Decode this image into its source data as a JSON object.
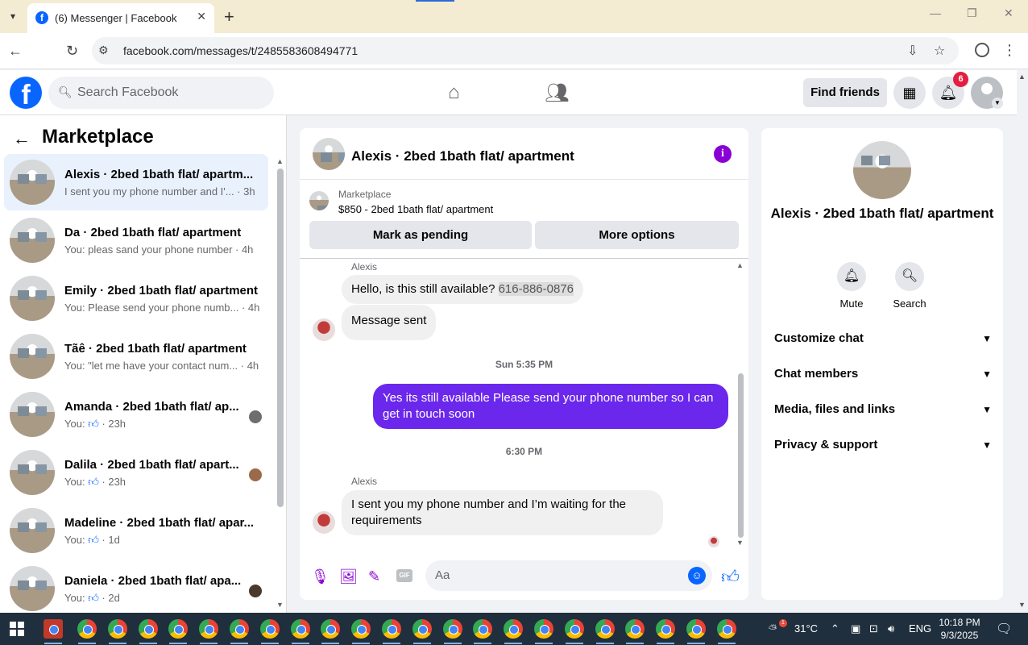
{
  "browser": {
    "tab_title": "(6) Messenger | Facebook",
    "url": "facebook.com/messages/t/2485583608494771"
  },
  "header": {
    "search_placeholder": "Search Facebook",
    "find_friends": "Find friends",
    "notification_count": "6"
  },
  "sidebar": {
    "title": "Marketplace",
    "conversations": [
      {
        "name": "Alexis · 2bed 1bath flat/ apartm...",
        "preview": "I sent you my phone number and I'... · 3h",
        "active": true
      },
      {
        "name": "Da · 2bed 1bath flat/ apartment",
        "preview": "You: pleas sand your phone number · 4h"
      },
      {
        "name": "Emily · 2bed 1bath flat/ apartment",
        "preview": "You: Please send your phone numb... · 4h"
      },
      {
        "name": "Tãê · 2bed 1bath flat/ apartment",
        "preview": "You: \"let me have your contact num... · 4h"
      },
      {
        "name": "Amanda · 2bed 1bath flat/ ap...",
        "preview_prefix": "You:",
        "preview_suffix": "· 23h"
      },
      {
        "name": "Dalila · 2bed 1bath flat/ apart...",
        "preview_prefix": "You:",
        "preview_suffix": "· 23h"
      },
      {
        "name": "Madeline · 2bed 1bath flat/ apar...",
        "preview_prefix": "You:",
        "preview_suffix": "· 1d"
      },
      {
        "name": "Daniela · 2bed 1bath flat/ apa...",
        "preview_prefix": "You:",
        "preview_suffix": "· 2d"
      }
    ]
  },
  "chat": {
    "title": "Alexis · 2bed 1bath flat/ apartment",
    "marketplace_label": "Marketplace",
    "listing": "$850 - 2bed 1bath flat/ apartment",
    "mark_pending": "Mark as pending",
    "more_options": "More options",
    "messages": {
      "sender1": "Alexis",
      "msg1_text": "Hello, is this still available?",
      "msg1_phone": "616-886-0876",
      "msg2": "Message sent",
      "time1": "Sun 5:35 PM",
      "msg3": "Yes its still available Please send your phone number so I can get in touch soon",
      "time2": "6:30 PM",
      "sender2": "Alexis",
      "msg4": "I sent you my phone number and I’m waiting for the requirements"
    },
    "composer_placeholder": "Aa"
  },
  "details": {
    "name": "Alexis · 2bed 1bath flat/ apartment",
    "mute": "Mute",
    "search": "Search",
    "sections": [
      "Customize chat",
      "Chat members",
      "Media, files and links",
      "Privacy & support"
    ]
  },
  "taskbar": {
    "temperature": "31°C",
    "language": "ENG",
    "time": "10:18 PM",
    "date": "9/3/2025",
    "weather_alert": "1"
  },
  "colors": {
    "fb_blue": "#0866ff",
    "messenger_purple": "#6b27ec",
    "active_conversation": "#e9f1fd"
  }
}
